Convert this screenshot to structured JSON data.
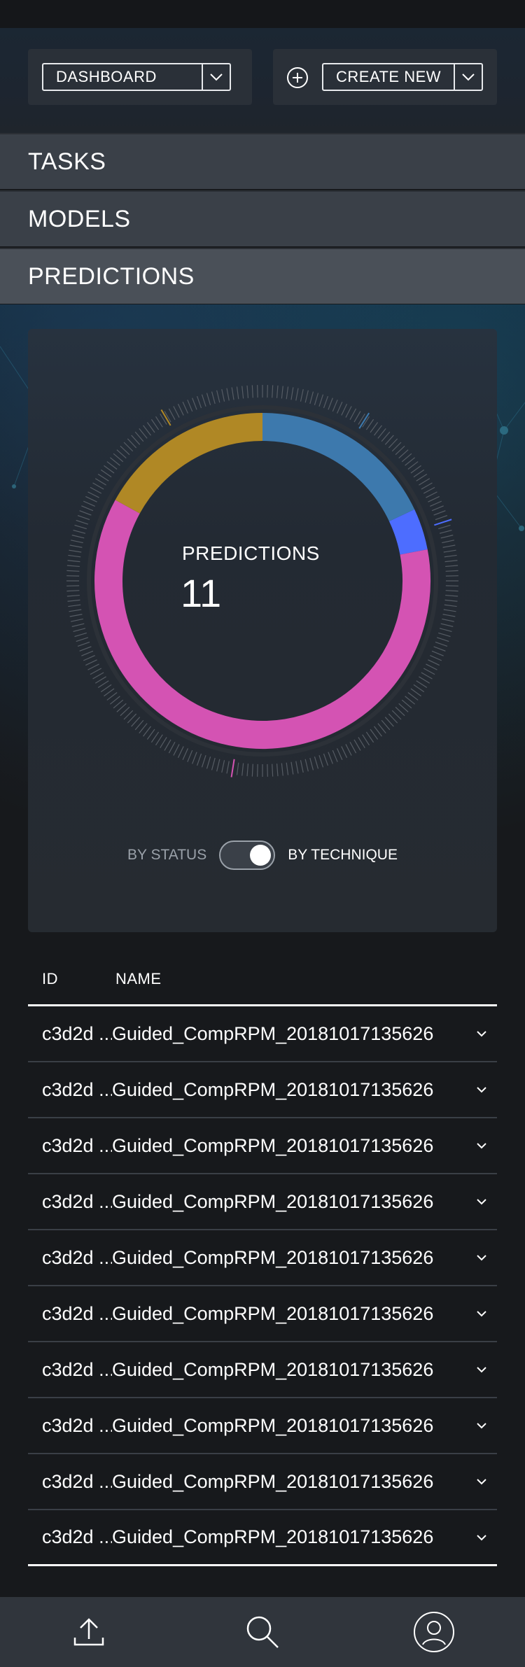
{
  "header": {
    "dashboard_select": {
      "label": "DASHBOARD"
    },
    "create_select": {
      "label": "CREATE NEW"
    }
  },
  "nav": {
    "items": [
      {
        "label": "TASKS"
      },
      {
        "label": "MODELS"
      },
      {
        "label": "PREDICTIONS"
      }
    ]
  },
  "summary": {
    "title": "PREDICTIONS",
    "value": "11",
    "toggle": {
      "off_label": "BY STATUS",
      "on_label": "BY TECHNIQUE"
    }
  },
  "chart_data": {
    "type": "pie",
    "style": "donut",
    "total": 11,
    "slices": [
      {
        "fraction": 0.18,
        "color": "#3d79ad"
      },
      {
        "fraction": 0.04,
        "color": "#4d6dff"
      },
      {
        "fraction": 0.61,
        "color": "#d453b3"
      },
      {
        "fraction": 0.17,
        "color": "#b08825"
      }
    ]
  },
  "table": {
    "headers": {
      "id": "ID",
      "name": "NAME"
    },
    "rows": [
      {
        "id": "c3d2d ...",
        "name": "Guided_CompRPM_20181017135626"
      },
      {
        "id": "c3d2d ...",
        "name": "Guided_CompRPM_20181017135626"
      },
      {
        "id": "c3d2d ...",
        "name": "Guided_CompRPM_20181017135626"
      },
      {
        "id": "c3d2d ...",
        "name": "Guided_CompRPM_20181017135626"
      },
      {
        "id": "c3d2d ...",
        "name": "Guided_CompRPM_20181017135626"
      },
      {
        "id": "c3d2d ...",
        "name": "Guided_CompRPM_20181017135626"
      },
      {
        "id": "c3d2d ...",
        "name": "Guided_CompRPM_20181017135626"
      },
      {
        "id": "c3d2d ...",
        "name": "Guided_CompRPM_20181017135626"
      },
      {
        "id": "c3d2d ...",
        "name": "Guided_CompRPM_20181017135626"
      },
      {
        "id": "c3d2d ...",
        "name": "Guided_CompRPM_20181017135626"
      }
    ]
  },
  "bottom_nav": {
    "icons": [
      "upload-icon",
      "search-icon",
      "user-icon"
    ]
  }
}
